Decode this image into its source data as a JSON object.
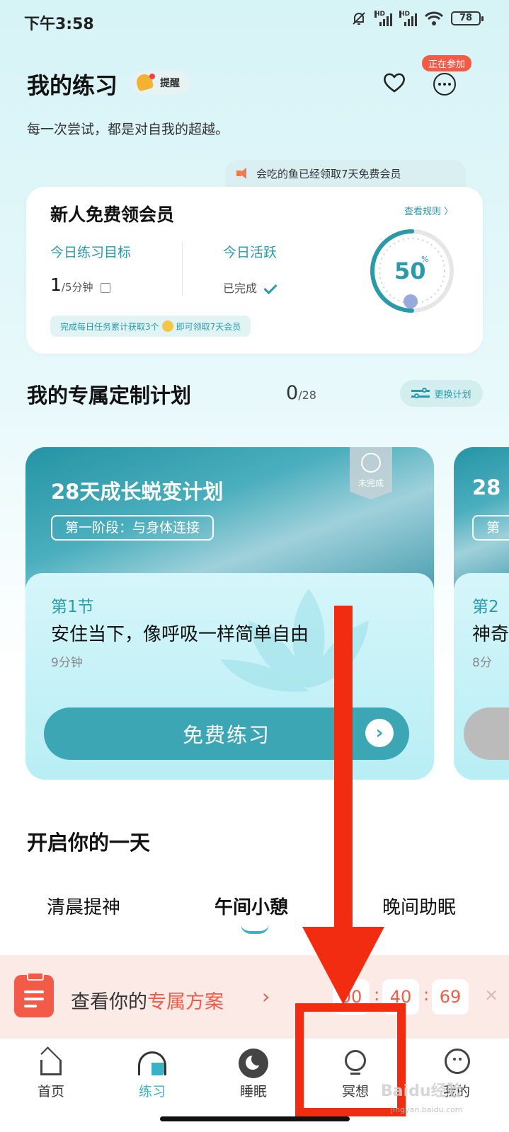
{
  "status_bar": {
    "time": "下午3:58",
    "battery": "78"
  },
  "header": {
    "title": "我的练习",
    "reminder_label": "提醒",
    "subtitle": "每一次尝试，都是对自我的超越。",
    "joining_badge": "正在参加"
  },
  "notice": {
    "text": "会吃的鱼已经领取7天免费会员"
  },
  "member_card": {
    "title": "新人免费领会员",
    "rules_link": "查看规则 〉",
    "goal_label": "今日练习目标",
    "goal_value": "1",
    "goal_unit": "/5分钟",
    "active_label": "今日活跃",
    "active_value": "已完成",
    "tip_prefix": "完成每日任务累计获取3个",
    "tip_suffix": "即可领取7天会员",
    "progress_value": "50",
    "progress_unit": "%",
    "progress_fraction": 0.5
  },
  "plan_section": {
    "title": "我的专属定制计划",
    "count": "0",
    "total": "/28",
    "change_button": "更换计划"
  },
  "plan_cards": [
    {
      "title": "28天成长蜕变计划",
      "stage": "第一阶段：与身体连接",
      "status": "未完成",
      "lesson_num": "第1节",
      "lesson_title": "安住当下，像呼吸一样简单自由",
      "duration": "9分钟",
      "button": "免费练习"
    },
    {
      "title": "28",
      "stage": "第",
      "lesson_num": "第2",
      "lesson_title": "神奇",
      "duration": "8分"
    }
  ],
  "day_section": {
    "title": "开启你的一天",
    "tabs": [
      "清晨提神",
      "午间小憩",
      "晚间助眠"
    ]
  },
  "promo": {
    "text_prefix": "查看你的",
    "text_highlight": "专属方案",
    "chevron": "›",
    "timer": [
      "00",
      "40",
      "69"
    ],
    "close": "×"
  },
  "nav": {
    "items": [
      {
        "label": "首页",
        "icon": "home-icon"
      },
      {
        "label": "练习",
        "icon": "practice-gauge-icon"
      },
      {
        "label": "睡眠",
        "icon": "moon-icon"
      },
      {
        "label": "冥想",
        "icon": "lightbulb-icon"
      },
      {
        "label": "我的",
        "icon": "profile-face-icon"
      }
    ],
    "active_index": 1
  },
  "watermark": {
    "text": "Baidu经验",
    "sub": "jingyan.baidu.com"
  },
  "colors": {
    "accent": "#39b3c3",
    "annotation": "#f22c10",
    "promo_red": "#f25b47"
  }
}
